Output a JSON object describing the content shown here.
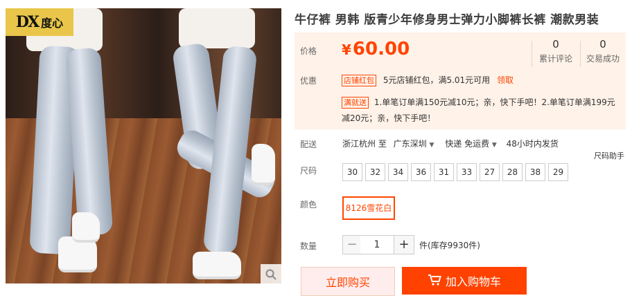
{
  "logo": {
    "mark": "DX",
    "name": "度心"
  },
  "product": {
    "title": "牛仔裤 男韩 版青少年修身男士弹力小脚裤长裤 潮款男装"
  },
  "price": {
    "label": "价格",
    "currency": "¥",
    "value": "60.00"
  },
  "stats": {
    "reviews": {
      "count": "0",
      "label": "累计评论"
    },
    "sales": {
      "count": "0",
      "label": "交易成功"
    }
  },
  "promo": {
    "label": "优惠",
    "shop_tag": "店铺红包",
    "shop_text": "5元店铺红包，满5.01元可用",
    "claim": "领取",
    "discount_tag": "满就送",
    "discount_line1": "1.单笔订单满150元减10元；亲，快下手吧！2.单笔订单满199元",
    "discount_line2": "减20元；亲，快下手吧！"
  },
  "shipping": {
    "label": "配送",
    "from": "浙江杭州 至",
    "to": "广东深圳",
    "method": "快递 免运费",
    "dispatch": "48小时内发货",
    "size_helper": "尺码助手"
  },
  "size": {
    "label": "尺码",
    "options": [
      "30",
      "32",
      "34",
      "36",
      "31",
      "33",
      "27",
      "28",
      "38",
      "29"
    ]
  },
  "color": {
    "label": "颜色",
    "selected": "8126雪花白"
  },
  "quantity": {
    "label": "数量",
    "value": "1",
    "minus": "−",
    "plus": "+",
    "stock": "件(库存9930件)"
  },
  "actions": {
    "buy": "立即购买",
    "cart": "加入购物车"
  },
  "colors": {
    "accent": "#ff4400",
    "cart_bg": "#ff4200",
    "price_bg": "#fff2e8",
    "logo_bg": "#e9c64a"
  }
}
